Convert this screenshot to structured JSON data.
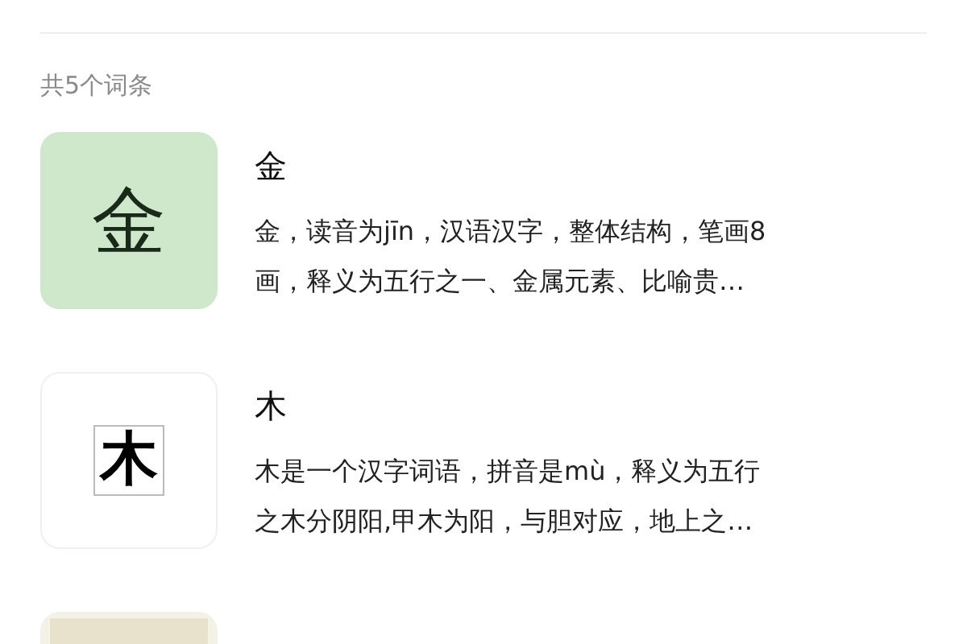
{
  "result_count": "共5个词条",
  "entries": [
    {
      "thumb": {
        "kind": "tinted",
        "glyph": "金"
      },
      "title": "金",
      "description_lines": [
        "金，读音为jīn，汉语汉字，整体结构，笔画8",
        "画，释义为五行之一、金属元素、比喻贵…"
      ]
    },
    {
      "thumb": {
        "kind": "boxed",
        "glyph": "木"
      },
      "title": "木",
      "description_lines": [
        "木是一个汉字词语，拼音是mù，释义为五行",
        "之木分阴阳,甲木为阳，与胆对应，地上之…"
      ]
    },
    {
      "thumb": {
        "kind": "picture"
      }
    }
  ]
}
